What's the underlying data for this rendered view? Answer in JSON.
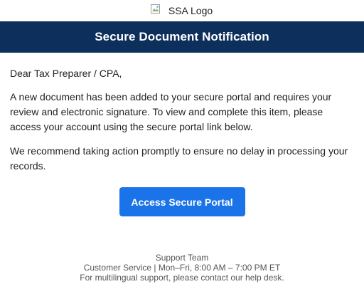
{
  "logo": {
    "alt_text": "SSA Logo"
  },
  "header": {
    "title": "Secure Document Notification",
    "background_color": "#0c2f5c"
  },
  "body": {
    "greeting": "Dear Tax Preparer / CPA,",
    "paragraph_1": "A new document has been added to your secure portal and requires your review and electronic signature. To view and complete this item, please access your account using the secure portal link below.",
    "paragraph_2": "We recommend taking action promptly to ensure no delay in processing your records."
  },
  "cta": {
    "label": "Access Secure Portal",
    "color": "#1a73e8"
  },
  "footer": {
    "line_1": "Support Team",
    "line_2": "Customer Service | Mon–Fri, 8:00 AM – 7:00 PM ET",
    "line_3": "For multilingual support, please contact our help desk."
  }
}
